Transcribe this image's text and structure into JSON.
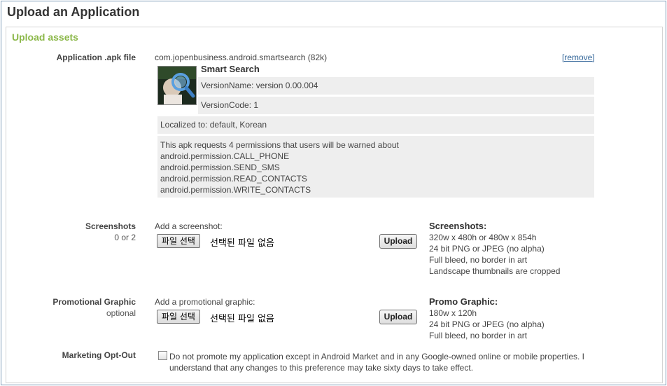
{
  "page": {
    "title": "Upload an Application"
  },
  "section": {
    "title": "Upload assets"
  },
  "apk": {
    "label": "Application .apk file",
    "filename": "com.jopenbusiness.android.smartsearch (82k)",
    "remove_label": "[remove]",
    "app_name": "Smart Search",
    "version_name": "VersionName: version 0.00.004",
    "version_code": "VersionCode: 1",
    "localized": "Localized to: default, Korean",
    "permissions_intro": "This apk requests 4 permissions that users will be warned about",
    "permissions": [
      "android.permission.CALL_PHONE",
      "android.permission.SEND_SMS",
      "android.permission.READ_CONTACTS",
      "android.permission.WRITE_CONTACTS"
    ]
  },
  "screenshots": {
    "label": "Screenshots",
    "sub": "0 or 2",
    "add_label": "Add a screenshot:",
    "file_button": "파일 선택",
    "file_status": "선택된 파일 없음",
    "upload_button": "Upload",
    "spec_title": "Screenshots:",
    "spec_lines": [
      "320w x 480h or 480w x 854h",
      "24 bit PNG or JPEG (no alpha)",
      "Full bleed, no border in art",
      "Landscape thumbnails are cropped"
    ]
  },
  "promo": {
    "label": "Promotional Graphic",
    "sub": "optional",
    "add_label": "Add a promotional graphic:",
    "file_button": "파일 선택",
    "file_status": "선택된 파일 없음",
    "upload_button": "Upload",
    "spec_title": "Promo Graphic:",
    "spec_lines": [
      "180w x 120h",
      "24 bit PNG or JPEG (no alpha)",
      "Full bleed, no border in art"
    ]
  },
  "marketing": {
    "label": "Marketing Opt-Out",
    "checked": false,
    "text": "Do not promote my application except in Android Market and in any Google-owned online or mobile properties. I understand that any changes to this preference may take sixty days to take effect."
  }
}
